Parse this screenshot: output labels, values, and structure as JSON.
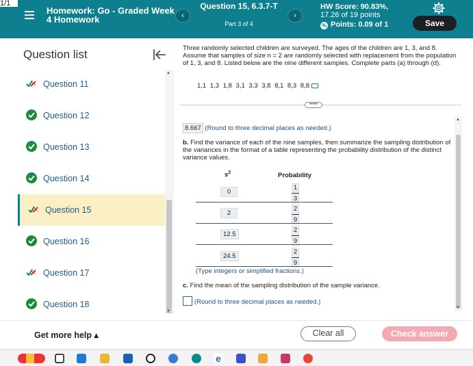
{
  "corner_text": "1/1",
  "header": {
    "menu_icon": "hamburger-icon",
    "hw_title": "Homework: Go - Graded Week 4 Homework",
    "prev_icon": "chevron-left-icon",
    "next_icon": "chevron-right-icon",
    "question_title": "Question 15, 6.3.7-T",
    "part_label": "Part 3 of 4",
    "hw_score": "HW Score: 90.83%,",
    "hw_points": "17.26 of 19 points",
    "question_points": "Points: 0.09 of 1",
    "settings_icon": "gear-icon",
    "save_label": "Save",
    "accent_color": "#0e7f8f"
  },
  "sidebar": {
    "title": "Question list",
    "collapse_icon": "collapse-left-icon",
    "items": [
      {
        "label": "Question 11",
        "status": "partial"
      },
      {
        "label": "Question 12",
        "status": "correct"
      },
      {
        "label": "Question 13",
        "status": "correct"
      },
      {
        "label": "Question 14",
        "status": "correct"
      },
      {
        "label": "Question 15",
        "status": "partial",
        "active": true
      },
      {
        "label": "Question 16",
        "status": "correct"
      },
      {
        "label": "Question 17",
        "status": "partial"
      },
      {
        "label": "Question 18",
        "status": "correct"
      }
    ]
  },
  "main": {
    "problem_text": "Three randomly selected children are surveyed. The ages of the children are 1, 3, and 8. Assume that samples of size n = 2 are randomly selected with replacement from the population of 1, 3, and 8. Listed below are the nine different samples. Complete parts (a) through (d).",
    "samples": "1,1   1,3   1,8   3,1   3,3   3,8   8,1   8,3   8,8",
    "more_label": "•••••",
    "part_a_answer": "8.667",
    "part_a_hint": "(Round to three decimal places as needed.)",
    "part_b_label": "b.",
    "part_b_text": "Find the variance of each of the nine samples, then summarize the sampling distribution of the variances in the format of a table representing the probability distribution of the distinct variance values.",
    "table": {
      "col1": "s",
      "col1_sup": "2",
      "col2": "Probability",
      "rows": [
        {
          "s2": "0",
          "num": "1",
          "den": "3"
        },
        {
          "s2": "2",
          "num": "2",
          "den": "9"
        },
        {
          "s2": "12.5",
          "num": "2",
          "den": "9"
        },
        {
          "s2": "24.5",
          "num": "2",
          "den": "9"
        }
      ]
    },
    "table_note": "(Type integers or simplified fractions.)",
    "part_c_label": "c.",
    "part_c_text": "Find the mean of the sampling distribution of the sample variance.",
    "part_c_hint": "(Round to three decimal places as needed.)"
  },
  "footer": {
    "help_label": "Get more help ▴",
    "clear_label": "Clear all",
    "check_label": "Check answer"
  }
}
